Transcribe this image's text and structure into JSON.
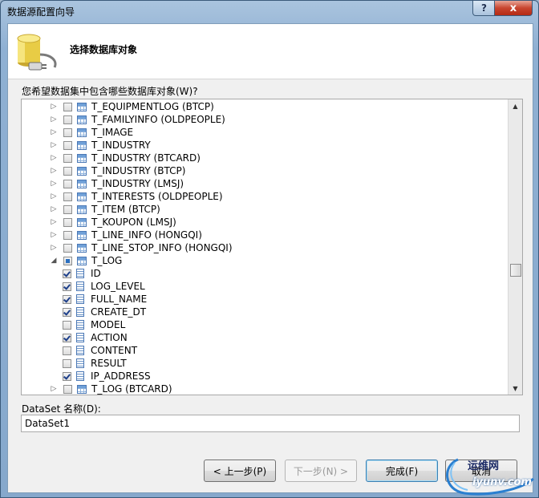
{
  "window": {
    "title": "数据源配置向导",
    "help_label": "?",
    "close_label": "x"
  },
  "header": {
    "title": "选择数据库对象"
  },
  "prompt": "您希望数据集中包含哪些数据库对象(W)?",
  "tree": {
    "items": [
      {
        "label": "T_EQUIPMENTLOG (BTCP)",
        "level": 0,
        "expander": "collapsed",
        "check": "unchecked",
        "icon": "table-icon"
      },
      {
        "label": "T_FAMILYINFO (OLDPEOPLE)",
        "level": 0,
        "expander": "collapsed",
        "check": "unchecked",
        "icon": "table-icon"
      },
      {
        "label": "T_IMAGE",
        "level": 0,
        "expander": "collapsed",
        "check": "unchecked",
        "icon": "table-icon"
      },
      {
        "label": "T_INDUSTRY",
        "level": 0,
        "expander": "collapsed",
        "check": "unchecked",
        "icon": "table-icon"
      },
      {
        "label": "T_INDUSTRY (BTCARD)",
        "level": 0,
        "expander": "collapsed",
        "check": "unchecked",
        "icon": "table-icon"
      },
      {
        "label": "T_INDUSTRY (BTCP)",
        "level": 0,
        "expander": "collapsed",
        "check": "unchecked",
        "icon": "table-icon"
      },
      {
        "label": "T_INDUSTRY (LMSJ)",
        "level": 0,
        "expander": "collapsed",
        "check": "unchecked",
        "icon": "table-icon"
      },
      {
        "label": "T_INTERESTS (OLDPEOPLE)",
        "level": 0,
        "expander": "collapsed",
        "check": "unchecked",
        "icon": "table-icon"
      },
      {
        "label": "T_ITEM (BTCP)",
        "level": 0,
        "expander": "collapsed",
        "check": "unchecked",
        "icon": "table-icon"
      },
      {
        "label": "T_KOUPON (LMSJ)",
        "level": 0,
        "expander": "collapsed",
        "check": "unchecked",
        "icon": "table-icon"
      },
      {
        "label": "T_LINE_INFO (HONGQI)",
        "level": 0,
        "expander": "collapsed",
        "check": "unchecked",
        "icon": "table-icon"
      },
      {
        "label": "T_LINE_STOP_INFO (HONGQI)",
        "level": 0,
        "expander": "collapsed",
        "check": "unchecked",
        "icon": "table-icon"
      },
      {
        "label": "T_LOG",
        "level": 0,
        "expander": "expanded",
        "check": "partial",
        "icon": "table-icon"
      },
      {
        "label": "ID",
        "level": 1,
        "expander": "none",
        "check": "checked",
        "icon": "column-icon"
      },
      {
        "label": "LOG_LEVEL",
        "level": 1,
        "expander": "none",
        "check": "checked",
        "icon": "column-icon"
      },
      {
        "label": "FULL_NAME",
        "level": 1,
        "expander": "none",
        "check": "checked",
        "icon": "column-icon"
      },
      {
        "label": "CREATE_DT",
        "level": 1,
        "expander": "none",
        "check": "checked",
        "icon": "column-icon"
      },
      {
        "label": "MODEL",
        "level": 1,
        "expander": "none",
        "check": "unchecked",
        "icon": "column-icon"
      },
      {
        "label": "ACTION",
        "level": 1,
        "expander": "none",
        "check": "checked",
        "icon": "column-icon"
      },
      {
        "label": "CONTENT",
        "level": 1,
        "expander": "none",
        "check": "unchecked",
        "icon": "column-icon"
      },
      {
        "label": "RESULT",
        "level": 1,
        "expander": "none",
        "check": "unchecked",
        "icon": "column-icon"
      },
      {
        "label": "IP_ADDRESS",
        "level": 1,
        "expander": "none",
        "check": "checked",
        "icon": "column-icon"
      },
      {
        "label": "T_LOG (BTCARD)",
        "level": 0,
        "expander": "collapsed",
        "check": "unchecked",
        "icon": "table-icon"
      }
    ]
  },
  "dataset": {
    "label": "DataSet 名称(D):",
    "value": "DataSet1"
  },
  "buttons": {
    "back": "< 上一步(P)",
    "next": "下一步(N) >",
    "finish": "完成(F)",
    "cancel": "取消"
  },
  "watermark": {
    "line1": "运维网",
    "line2": "iyunv.com"
  }
}
